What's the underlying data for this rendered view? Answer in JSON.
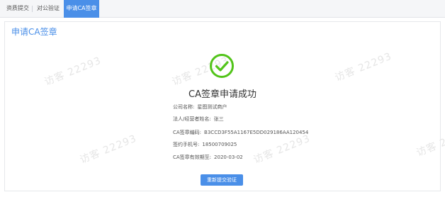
{
  "tabs": [
    {
      "label": "资质提交"
    },
    {
      "label": "对公验证"
    },
    {
      "label": "申请CA签章",
      "active": true
    }
  ],
  "page_title": "申请CA签章",
  "watermark": "访客 22293",
  "success_message": "CA签章申请成功",
  "info": [
    {
      "label": "公司名称:",
      "value": "星图测试商户"
    },
    {
      "label": "法人/经营者姓名:",
      "value": "张三"
    },
    {
      "label": "CA签章编码:",
      "value": "B3CCD3F55A1167E5DD029186AA120454"
    },
    {
      "label": "签约手机号:",
      "value": "18500709025"
    },
    {
      "label": "CA签章有效期至:",
      "value": "2020-03-02"
    }
  ],
  "resubmit_button": "重新提交验证",
  "colors": {
    "accent": "#4a8fe8",
    "success": "#52c41a"
  },
  "icons": {
    "success": "check-circle-icon"
  }
}
